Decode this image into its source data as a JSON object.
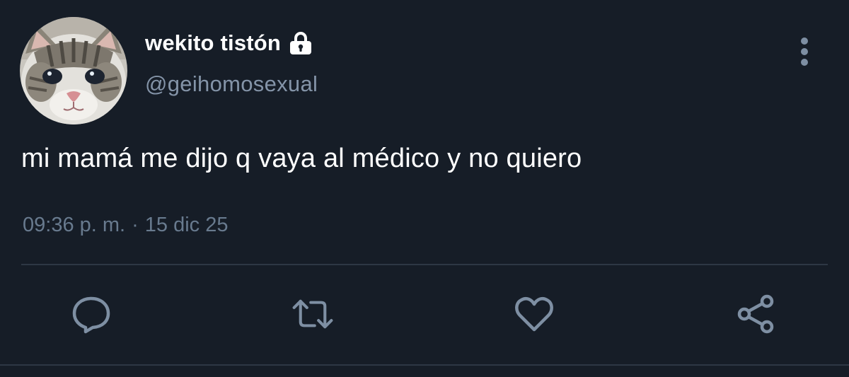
{
  "author": {
    "display_name": "wekito tistón",
    "handle": "@geihomosexual",
    "protected_icon": "lock-icon",
    "avatar": "cat-avatar"
  },
  "tweet": {
    "text": "mi mamá me dijo q vaya al médico y no quiero",
    "time": "09:36 p. m.",
    "separator": "·",
    "date": "15 dic 25"
  },
  "actions": [
    {
      "icon": "reply-icon"
    },
    {
      "icon": "retweet-icon"
    },
    {
      "icon": "like-icon"
    },
    {
      "icon": "share-icon"
    }
  ],
  "menu_icon": "more-options-icon",
  "colors": {
    "background": "#161d27",
    "text": "#ffffff",
    "secondary_text": "#8494a8",
    "muted_text": "#687a8e",
    "icon": "#7e8fa3",
    "divider": "#2d3744"
  }
}
